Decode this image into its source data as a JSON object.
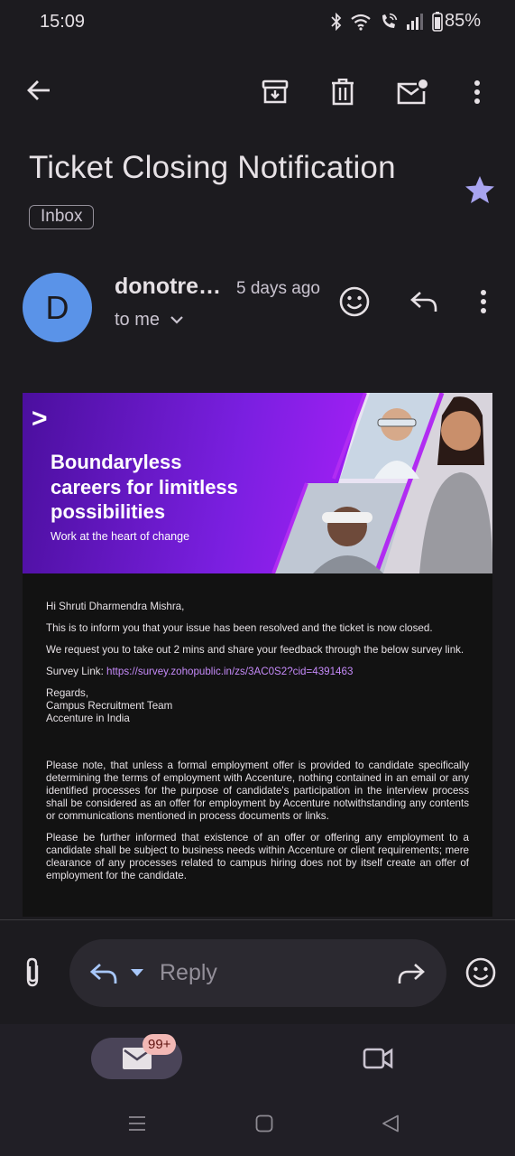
{
  "status_bar": {
    "time": "15:09",
    "battery": "85%",
    "icons": [
      "bluetooth-icon",
      "wifi-icon",
      "wifi-calling-icon",
      "signal-icon",
      "battery-icon"
    ]
  },
  "toolbar": {
    "icons": [
      "back-arrow-icon",
      "archive-icon",
      "delete-icon",
      "mark-unread-icon",
      "more-vert-icon"
    ]
  },
  "email": {
    "subject": "Ticket Closing Notification",
    "label": "Inbox",
    "starred": true,
    "sender": {
      "initial": "D",
      "name": "donotre…",
      "time": "5 days ago",
      "recipient": "to me",
      "avatar_color": "#5a93e8"
    },
    "banner": {
      "logo": ">",
      "headline_lines": [
        "Boundaryless",
        "careers for limitless",
        "possibilities"
      ],
      "tagline": "Work at the heart of change"
    },
    "body": {
      "greeting": "Hi Shruti Dharmendra Mishra,",
      "para1": "This is to inform you that your issue has been resolved and the ticket is now closed.",
      "para2": "We request you to take out 2 mins and share your feedback through the below survey link.",
      "survey_label": "Survey Link: ",
      "survey_url": "https://survey.zohopublic.in/zs/3AC0S2?cid=4391463",
      "sign_off": "Regards,",
      "team": "Campus Recruitment Team",
      "company": "Accenture in India",
      "disclaimer1": "Please note, that unless a formal employment offer is provided to candidate specifically determining the terms of employment with Accenture, nothing contained in an email or any identified processes for the purpose of candidate's participation in the interview process shall be considered as an offer for employment by Accenture notwithstanding any contents or communications mentioned in process documents or links.",
      "disclaimer2": "Please be further informed that existence of an offer or offering any employment to a candidate shall be subject to business needs within Accenture or client requirements; mere clearance of any processes related to campus hiring does not by itself create an offer of employment for the candidate."
    }
  },
  "reply_bar": {
    "placeholder": "Reply"
  },
  "bottom_nav": {
    "mail_badge": "99+"
  },
  "colors": {
    "background": "#1c1b1f",
    "accent_star": "#a8a4f0",
    "link": "#c58af9",
    "badge": "#f2b8b5"
  }
}
